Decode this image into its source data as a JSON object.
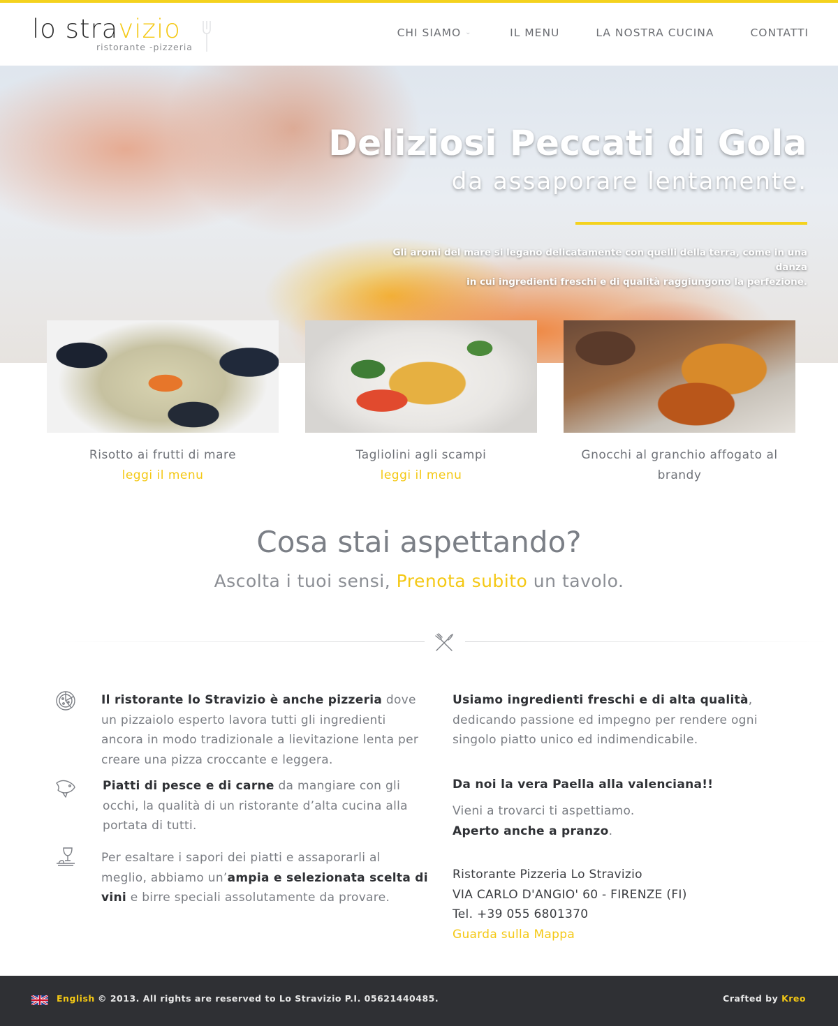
{
  "colors": {
    "accent": "#f4c814",
    "footer_bg": "#2f3034",
    "text": "#6f7278"
  },
  "logo": {
    "main_prefix": "lo stra",
    "main_accent": "vizio",
    "sub": "ristorante -pizzeria",
    "icon": "fork-icon"
  },
  "nav": [
    {
      "label": "CHI SIAMO",
      "has_dropdown": true
    },
    {
      "label": "IL MENU"
    },
    {
      "label": "LA NOSTRA CUCINA"
    },
    {
      "label": "CONTATTI"
    }
  ],
  "hero": {
    "title": "Deliziosi Peccati di Gola",
    "subtitle": "da assaporare lentamente.",
    "text_line1": "Gli aromi del mare si legano delicatamente con quelli della terra, come in una danza",
    "text_line2": "in cui ingredienti freschi e di qualità raggiungono la perfezione."
  },
  "dishes": [
    {
      "name": "Risotto ai frutti di mare",
      "link": "leggi il menu"
    },
    {
      "name": "Tagliolini agli scampi",
      "link": "leggi il menu"
    },
    {
      "name": "Gnocchi al granchio affogato al brandy",
      "link": ""
    }
  ],
  "cta": {
    "title": "Cosa stai aspettando?",
    "sub_before": "Ascolta i tuoi sensi, ",
    "sub_link": "Prenota subito",
    "sub_after": " un tavolo.",
    "divider_icon": "fork-knife-icon"
  },
  "features": [
    {
      "icon": "pizza-icon",
      "bold": "Il ristorante lo Stravizio è anche pizzeria",
      "text": " dove un pizzaiolo esperto lavora tutti gli ingredienti ancora in modo tradizionale a lievitazione lenta per creare una pizza croccante e leggera."
    },
    {
      "icon": "fish-icon",
      "bold": "Piatti di pesce e di carne",
      "text": " da mangiare con gli occhi, la qualità di un ristorante d’alta cucina alla portata di tutti."
    },
    {
      "icon": "wine-glass-icon",
      "before": "Per esaltare i sapori dei piatti e assaporarli al meglio, abbiamo un’",
      "bold": "ampia e selezionata scelta di vini",
      "after": " e birre speciali assolutamente da provare."
    }
  ],
  "right": {
    "p1_bold": "Usiamo ingredienti freschi e di alta qualità",
    "p1_text": ", dedicando passione ed impegno per rendere ogni singolo piatto unico ed indimendicabile.",
    "p2_bold": "Da noi la vera Paella alla valenciana!!",
    "p3_text": "Vieni a trovarci ti aspettiamo.",
    "p3_bold": "Aperto anche a pranzo",
    "p3_end": ".",
    "addr_name": "Ristorante Pizzeria Lo Stravizio",
    "addr_street": "VIA CARLO D'ANGIO' 60 - FIRENZE (FI)",
    "addr_tel": "Tel. +39 055 6801370",
    "map_link": "Guarda sulla Mappa"
  },
  "footer": {
    "flag_icon": "uk-flag-icon",
    "lang": "English",
    "copyright": "© 2013. All rights are reserved to Lo Stravizio P.I. 05621440485.",
    "crafted_prefix": "Crafted by ",
    "crafted_by": "Kreo"
  }
}
